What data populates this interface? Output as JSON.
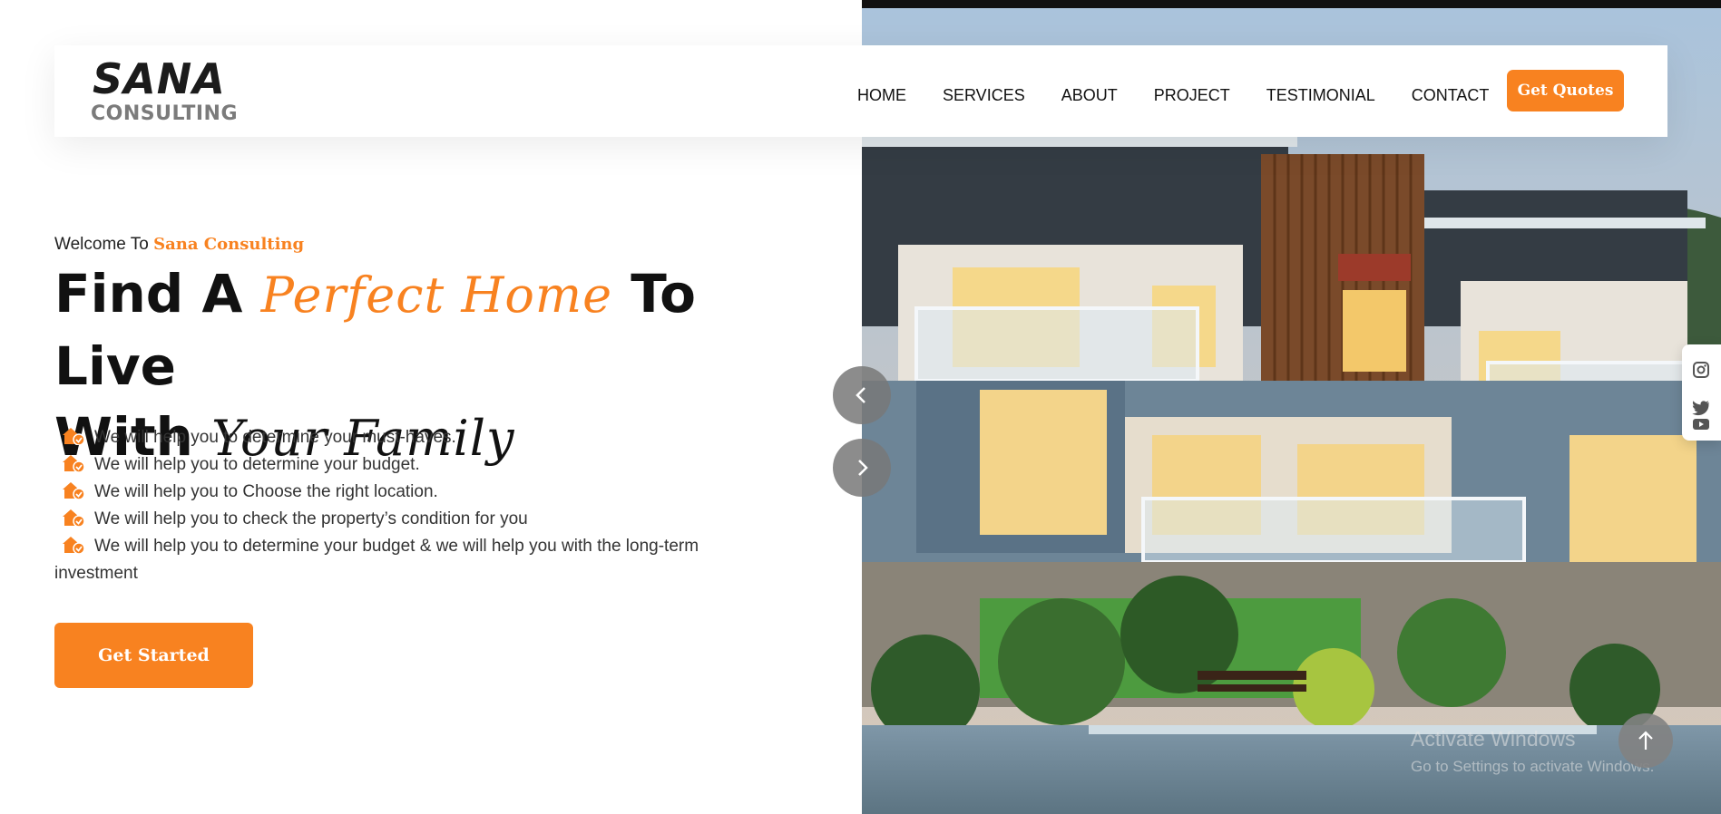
{
  "header": {
    "logo_top": "SANA",
    "logo_bottom": "CONSULTING",
    "nav": [
      "HOME",
      "SERVICES",
      "ABOUT",
      "PROJECT",
      "TESTIMONIAL",
      "CONTACT"
    ],
    "quote_button": "Get Quotes"
  },
  "hero": {
    "welcome_prefix": "Welcome To",
    "welcome_brand": "Sana Consulting",
    "headline": {
      "part1": "Find A ",
      "part2": "Perfect Home",
      "part3": " To Live",
      "part4": "With ",
      "part5": "Your Family"
    },
    "features": [
      "We will help you to determine your must-haves.",
      "We will help you to determine your budget.",
      "We will help you to Choose the right location.",
      "We will help you to check the property’s condition for you",
      "We will help you to determine your budget & we will help you with the long-term investment"
    ],
    "cta": "Get Started",
    "feature_icon": "home-check-icon"
  },
  "slider": {
    "prev_icon": "chevron-left-icon",
    "next_icon": "chevron-right-icon"
  },
  "social": [
    "instagram-icon",
    "twitter-icon",
    "youtube-icon"
  ],
  "watermark": {
    "line1": "Activate Windows",
    "line2": "Go to Settings to activate Windows."
  },
  "colors": {
    "accent": "#f88220",
    "dark": "#111111"
  }
}
